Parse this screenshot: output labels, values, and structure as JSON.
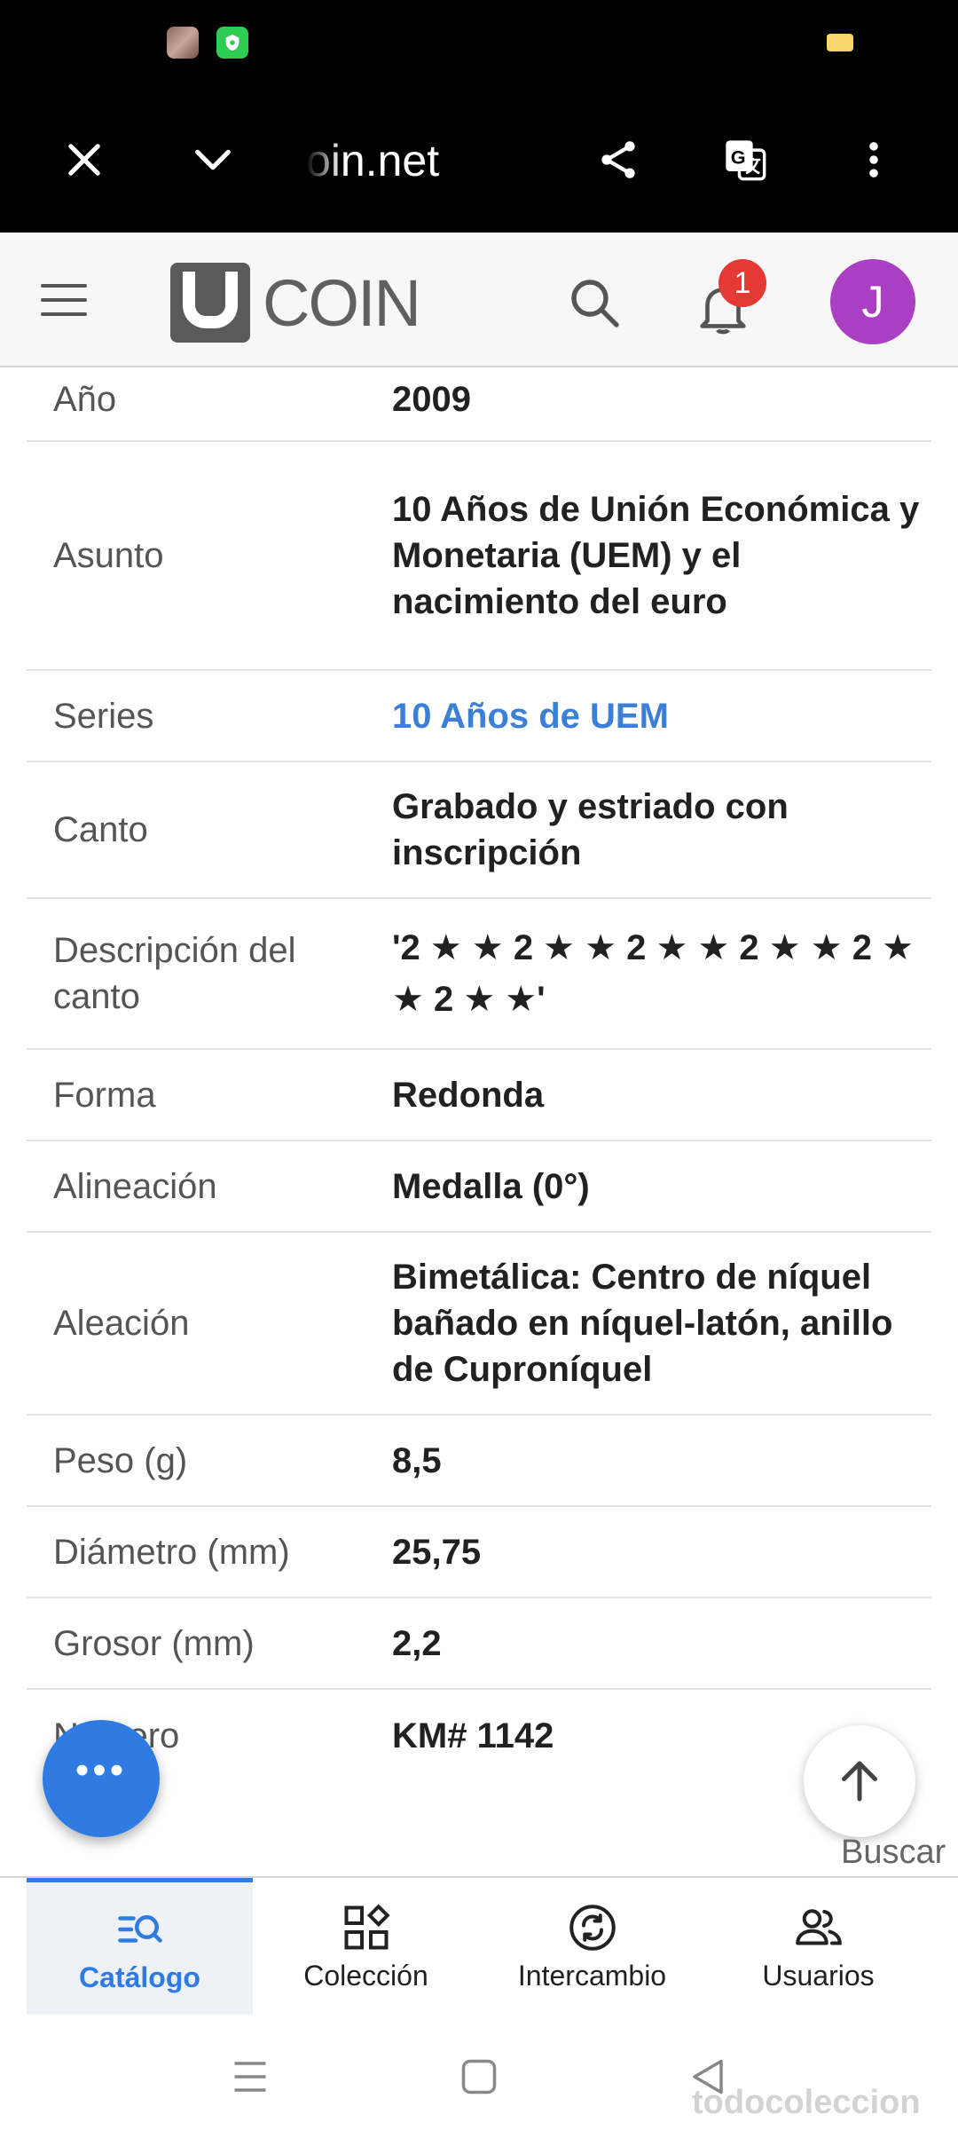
{
  "browser": {
    "url": "oin.net"
  },
  "header": {
    "logo_text": "COIN",
    "notification_count": "1",
    "avatar_initial": "J"
  },
  "details": [
    {
      "label": "Año",
      "value": "2009"
    },
    {
      "label": "Asunto",
      "value": "10 Años de Unión Económica y Monetaria (UEM) y el nacimiento del euro"
    },
    {
      "label": "Series",
      "value": "10 Años de UEM",
      "link": true
    },
    {
      "label": "Canto",
      "value": "Grabado y estriado con inscripción"
    },
    {
      "label": "Descripción del canto",
      "value": "'2 ★ ★ 2 ★ ★ 2 ★ ★ 2 ★ ★ 2 ★ ★ 2 ★ ★'"
    },
    {
      "label": "Forma",
      "value": "Redonda"
    },
    {
      "label": "Alineación",
      "value": "Medalla (0°)"
    },
    {
      "label": "Aleación",
      "value": "Bimetálica: Centro de níquel bañado en níquel-latón, anillo de Cuproníquel"
    },
    {
      "label": "Peso (g)",
      "value": "8,5"
    },
    {
      "label": "Diámetro (mm)",
      "value": "25,75"
    },
    {
      "label": "Grosor (mm)",
      "value": "2,2"
    },
    {
      "label": "Número",
      "value": "KM# 1142"
    }
  ],
  "fab": {
    "label": "•••"
  },
  "search_hint": "Buscar",
  "bottom_nav": [
    {
      "label": "Catálogo",
      "active": true,
      "icon": "catalog-search-icon"
    },
    {
      "label": "Colección",
      "active": false,
      "icon": "collection-icon"
    },
    {
      "label": "Intercambio",
      "active": false,
      "icon": "exchange-icon"
    },
    {
      "label": "Usuarios",
      "active": false,
      "icon": "users-icon"
    }
  ],
  "watermark": "todocoleccion",
  "colors": {
    "accent": "#2f7be1",
    "link": "#3b7fd8",
    "badge": "#e53935",
    "avatar": "#ab3fc4"
  }
}
